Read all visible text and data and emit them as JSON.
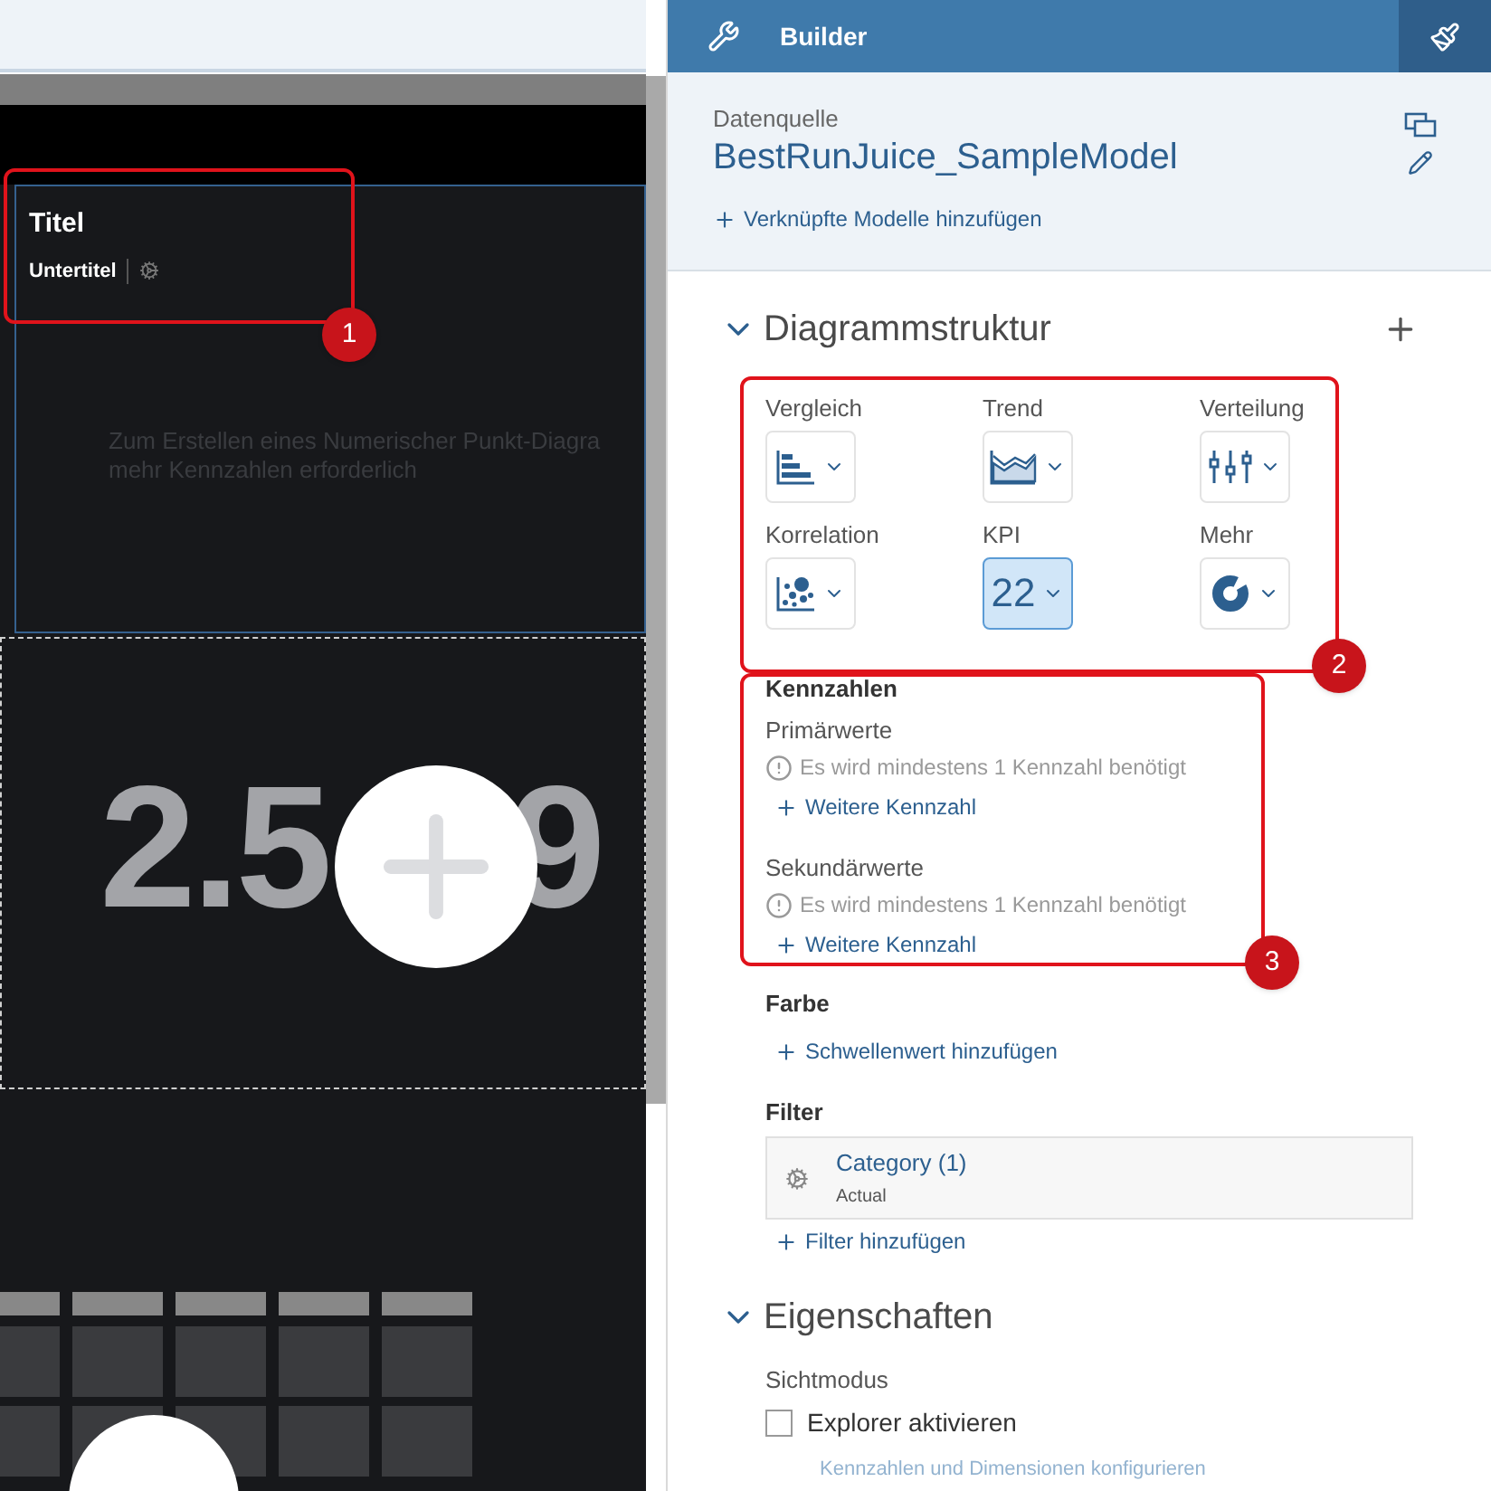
{
  "canvas": {
    "chart_tile": {
      "title": "Titel",
      "subtitle": "Untertitel",
      "message_lines": [
        "Zum Erstellen eines Numerischer Punkt-Diagra",
        "mehr Kennzahlen erforderlich"
      ]
    },
    "kpi_tile": {
      "value_parts": [
        "2.5",
        "9"
      ]
    }
  },
  "builder": {
    "title": "Builder"
  },
  "data_source": {
    "label": "Datenquelle",
    "name": "BestRunJuice_SampleModel",
    "link": "Verknüpfte Modelle hinzufügen"
  },
  "chart_structure": {
    "title": "Diagrammstruktur",
    "expanded": true,
    "types": [
      {
        "label": "Vergleich",
        "kind": "bar",
        "selected": false
      },
      {
        "label": "Trend",
        "kind": "area",
        "selected": false
      },
      {
        "label": "Verteilung",
        "kind": "boxplot",
        "selected": false
      },
      {
        "label": "Korrelation",
        "kind": "scatter",
        "selected": false
      },
      {
        "label": "KPI",
        "kind": "kpi",
        "icon_text": "22",
        "selected": true
      },
      {
        "label": "Mehr",
        "kind": "donut",
        "selected": false
      }
    ]
  },
  "measures": {
    "title": "Kennzahlen",
    "groups": [
      {
        "label": "Primärwerte",
        "warning": "Es wird mindestens 1 Kennzahl benötigt",
        "link": "Weitere Kennzahl"
      },
      {
        "label": "Sekundärwerte",
        "warning": "Es wird mindestens 1 Kennzahl benötigt",
        "link": "Weitere Kennzahl"
      }
    ]
  },
  "color": {
    "title": "Farbe",
    "link": "Schwellenwert hinzufügen"
  },
  "filter": {
    "title": "Filter",
    "chips": [
      {
        "name": "Category (1)",
        "value": "Actual"
      }
    ],
    "link": "Filter hinzufügen"
  },
  "properties": {
    "title": "Eigenschaften",
    "expanded": true,
    "view_mode_label": "Sichtmodus",
    "explorer": {
      "label": "Explorer aktivieren",
      "checked": false
    },
    "configure_link": {
      "label": "Kennzahlen und Dimensionen konfigurieren",
      "disabled": true
    }
  },
  "annotations": [
    {
      "label": "1"
    },
    {
      "label": "2"
    },
    {
      "label": "3"
    }
  ]
}
